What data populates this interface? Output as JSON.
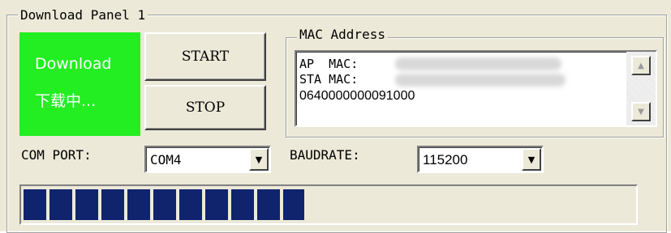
{
  "panel": {
    "title": "Download Panel 1"
  },
  "status": {
    "line1": "Download",
    "line2": "下载中...",
    "color": "#22ee22"
  },
  "buttons": {
    "start": "START",
    "stop": "STOP"
  },
  "mac_group": {
    "title": "MAC Address",
    "lines": [
      "AP  MAC:",
      "STA MAC:  ",
      "0640000000091000"
    ]
  },
  "com_port": {
    "label": "COM PORT:",
    "value": "COM4"
  },
  "baudrate": {
    "label": "BAUDRATE:",
    "value": "115200"
  },
  "progress": {
    "fraction": 0.46,
    "color": "#10246e"
  }
}
